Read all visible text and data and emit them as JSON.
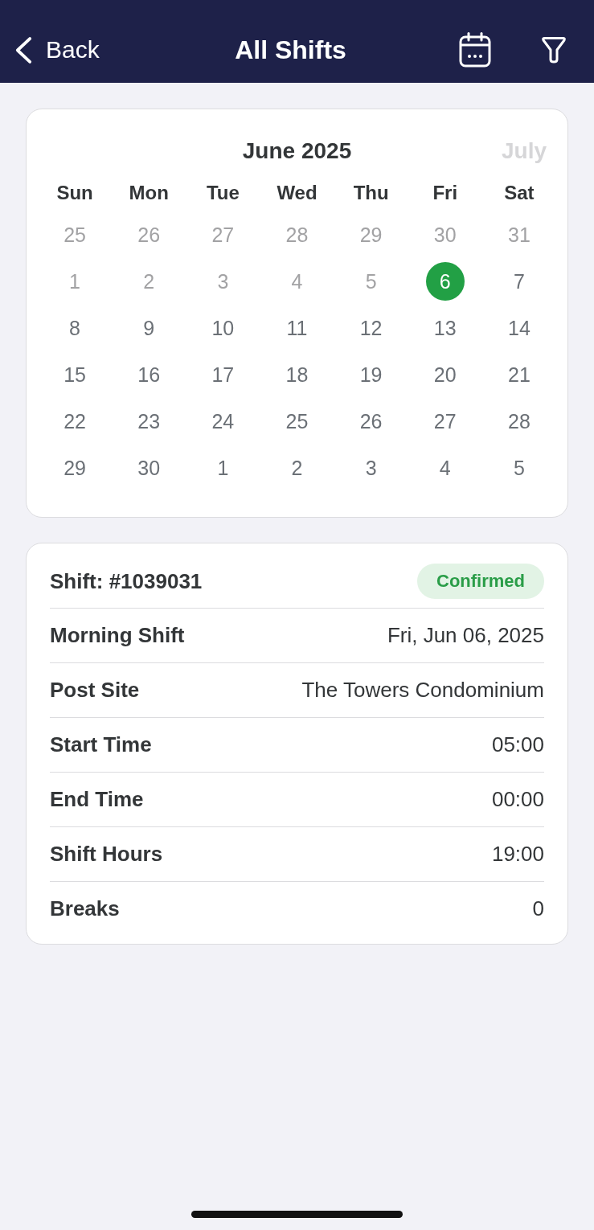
{
  "header": {
    "back_label": "Back",
    "title": "All Shifts"
  },
  "calendar": {
    "month": "June 2025",
    "next_month": "July",
    "weekdays": [
      "Sun",
      "Mon",
      "Tue",
      "Wed",
      "Thu",
      "Fri",
      "Sat"
    ],
    "weeks": [
      {
        "days": [
          {
            "label": "25",
            "dimmed": true,
            "selected": false
          },
          {
            "label": "26",
            "dimmed": true,
            "selected": false
          },
          {
            "label": "27",
            "dimmed": true,
            "selected": false
          },
          {
            "label": "28",
            "dimmed": true,
            "selected": false
          },
          {
            "label": "29",
            "dimmed": true,
            "selected": false
          },
          {
            "label": "30",
            "dimmed": true,
            "selected": false
          },
          {
            "label": "31",
            "dimmed": true,
            "selected": false
          }
        ]
      },
      {
        "days": [
          {
            "label": "1",
            "dimmed": true,
            "selected": false
          },
          {
            "label": "2",
            "dimmed": true,
            "selected": false
          },
          {
            "label": "3",
            "dimmed": true,
            "selected": false
          },
          {
            "label": "4",
            "dimmed": true,
            "selected": false
          },
          {
            "label": "5",
            "dimmed": true,
            "selected": false
          },
          {
            "label": "6",
            "dimmed": false,
            "selected": true
          },
          {
            "label": "7",
            "dimmed": false,
            "selected": false
          }
        ]
      },
      {
        "days": [
          {
            "label": "8",
            "dimmed": false,
            "selected": false
          },
          {
            "label": "9",
            "dimmed": false,
            "selected": false
          },
          {
            "label": "10",
            "dimmed": false,
            "selected": false
          },
          {
            "label": "11",
            "dimmed": false,
            "selected": false
          },
          {
            "label": "12",
            "dimmed": false,
            "selected": false
          },
          {
            "label": "13",
            "dimmed": false,
            "selected": false
          },
          {
            "label": "14",
            "dimmed": false,
            "selected": false
          }
        ]
      },
      {
        "days": [
          {
            "label": "15",
            "dimmed": false,
            "selected": false
          },
          {
            "label": "16",
            "dimmed": false,
            "selected": false
          },
          {
            "label": "17",
            "dimmed": false,
            "selected": false
          },
          {
            "label": "18",
            "dimmed": false,
            "selected": false
          },
          {
            "label": "19",
            "dimmed": false,
            "selected": false
          },
          {
            "label": "20",
            "dimmed": false,
            "selected": false
          },
          {
            "label": "21",
            "dimmed": false,
            "selected": false
          }
        ]
      },
      {
        "days": [
          {
            "label": "22",
            "dimmed": false,
            "selected": false
          },
          {
            "label": "23",
            "dimmed": false,
            "selected": false
          },
          {
            "label": "24",
            "dimmed": false,
            "selected": false
          },
          {
            "label": "25",
            "dimmed": false,
            "selected": false
          },
          {
            "label": "26",
            "dimmed": false,
            "selected": false
          },
          {
            "label": "27",
            "dimmed": false,
            "selected": false
          },
          {
            "label": "28",
            "dimmed": false,
            "selected": false
          }
        ]
      },
      {
        "days": [
          {
            "label": "29",
            "dimmed": false,
            "selected": false
          },
          {
            "label": "30",
            "dimmed": false,
            "selected": false
          },
          {
            "label": "1",
            "dimmed": false,
            "selected": false
          },
          {
            "label": "2",
            "dimmed": false,
            "selected": false
          },
          {
            "label": "3",
            "dimmed": false,
            "selected": false
          },
          {
            "label": "4",
            "dimmed": false,
            "selected": false
          },
          {
            "label": "5",
            "dimmed": false,
            "selected": false
          }
        ]
      }
    ]
  },
  "shift": {
    "title": "Shift: #1039031",
    "status": {
      "label": "Confirmed",
      "kind": "confirmed"
    },
    "details": [
      {
        "label": "Morning Shift",
        "value": "Fri, Jun 06, 2025"
      },
      {
        "label": "Post Site",
        "value": "The Towers Condominium"
      },
      {
        "label": "Start Time",
        "value": "05:00"
      },
      {
        "label": "End Time",
        "value": "00:00"
      },
      {
        "label": "Shift Hours",
        "value": "19:00"
      },
      {
        "label": "Breaks",
        "value": "0"
      }
    ]
  }
}
